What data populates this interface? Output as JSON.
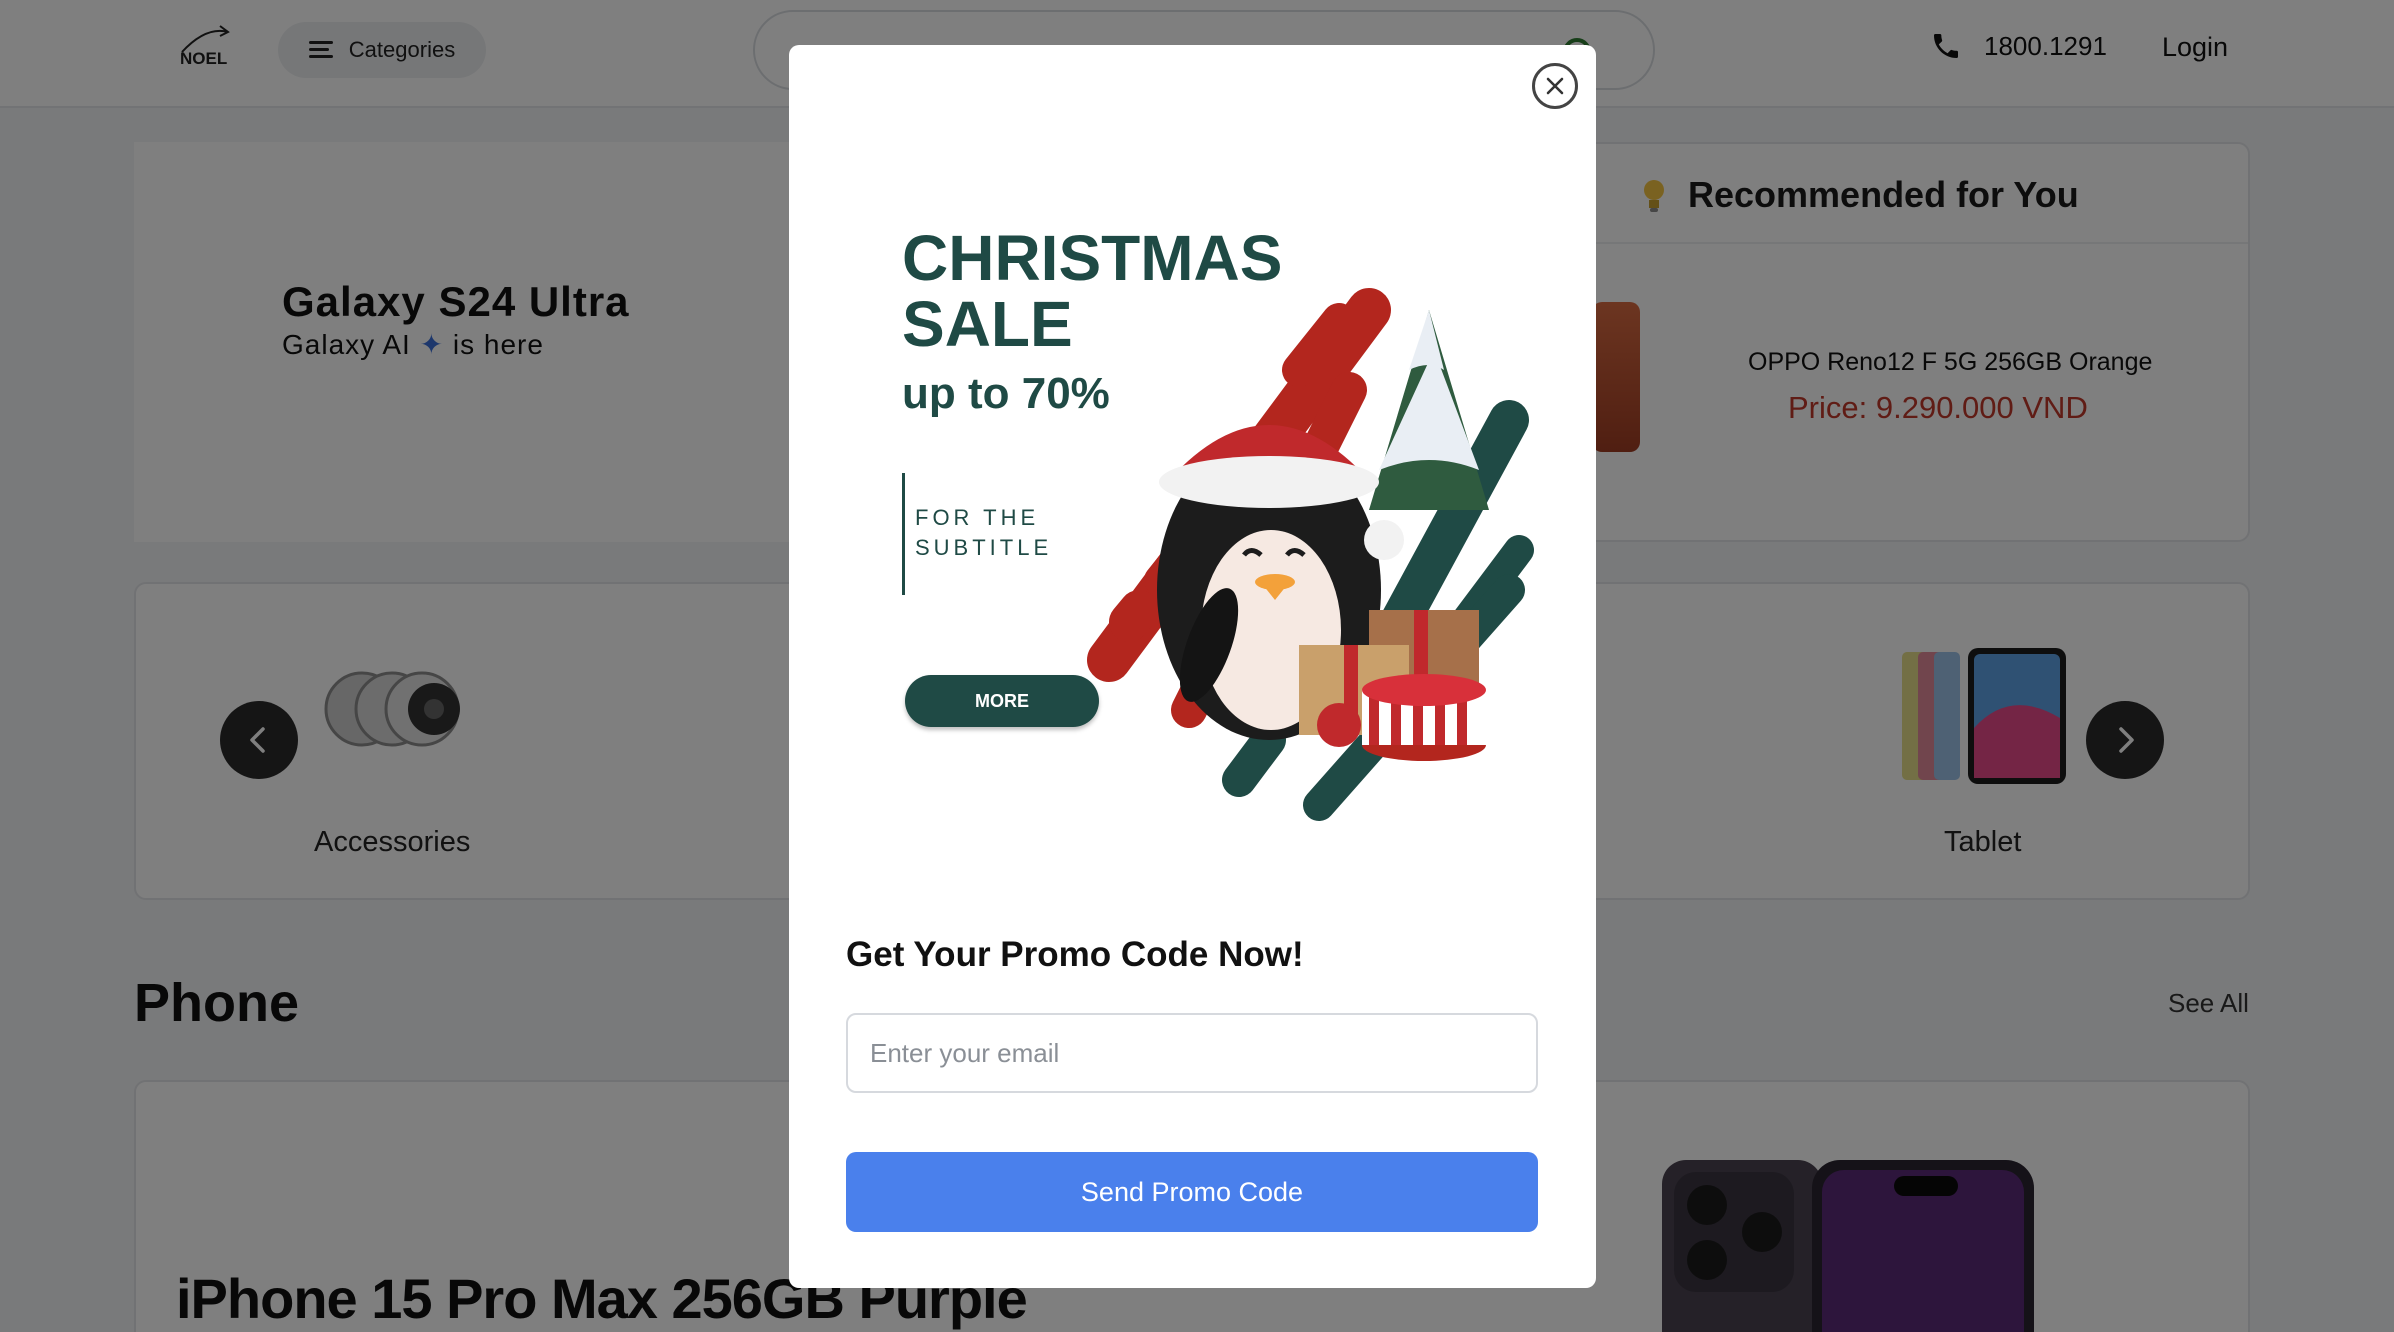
{
  "header": {
    "logo_text": "NOEL",
    "categories_label": "Categories",
    "phone_number": "1800.1291",
    "login_label": "Login"
  },
  "hero": {
    "title": "Galaxy S24 Ultra",
    "subtitle_prefix": "Galaxy AI",
    "subtitle_suffix": "is here"
  },
  "recommended": {
    "title": "Recommended for You",
    "product_name": "OPPO Reno12 F 5G 256GB Orange",
    "product_price": "Price: 9.290.000 VND"
  },
  "categories": {
    "items": [
      {
        "label": "Accessories"
      },
      {
        "label": "Tablet"
      }
    ]
  },
  "phone_section": {
    "title": "Phone",
    "see_all": "See All",
    "featured_product": "iPhone 15 Pro Max 256GB Purple"
  },
  "modal": {
    "banner": {
      "title": "CHRISTMAS SALE",
      "discount": "up to 70%",
      "subtitle": "FOR THE SUBTITLE",
      "more_label": "MORE"
    },
    "promo_title": "Get Your Promo Code Now!",
    "email_placeholder": "Enter your email",
    "email_value": "",
    "send_label": "Send Promo Code"
  },
  "colors": {
    "accent_button": "#4a80ec",
    "price_red": "#c0392b",
    "banner_green": "#1f4a45",
    "banner_red": "#b3261e"
  }
}
